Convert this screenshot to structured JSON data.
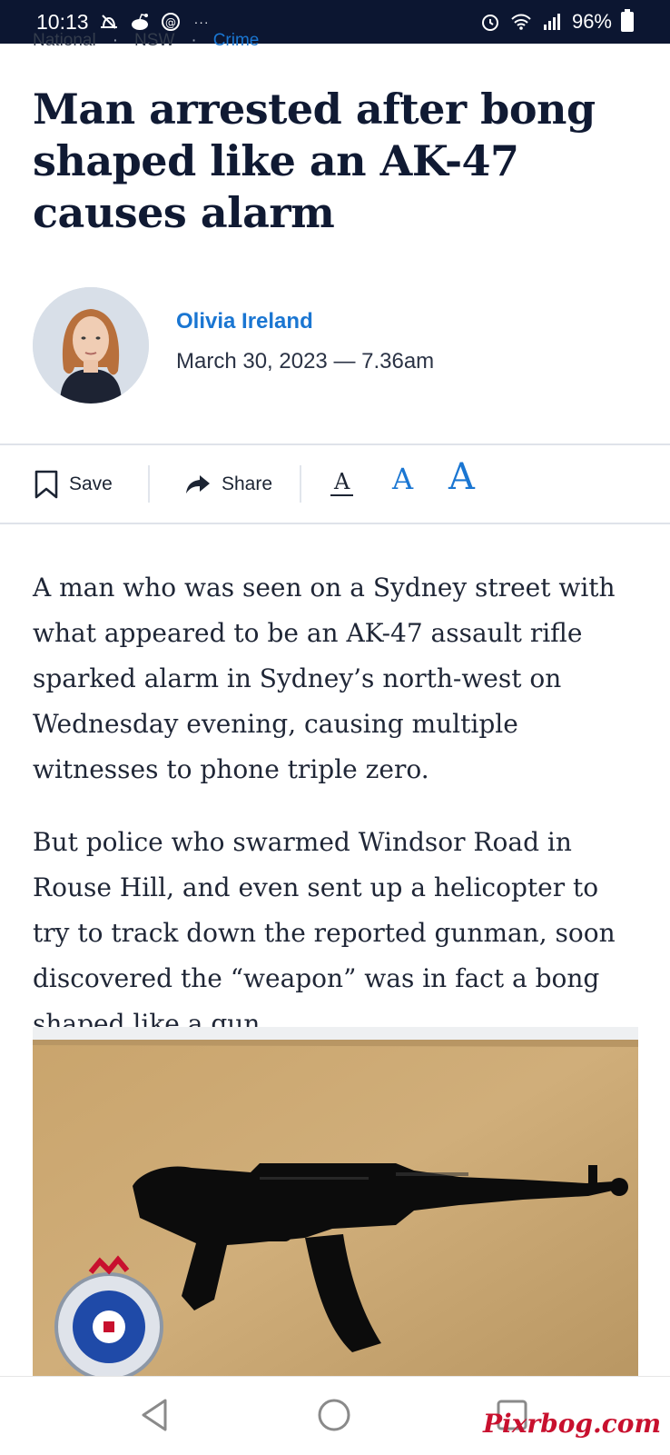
{
  "status_bar": {
    "time": "10:13",
    "more": "···",
    "battery": "96%",
    "icons": [
      "blocked-notification-icon",
      "reddit-icon",
      "app-icon",
      "alarm-icon",
      "wifi-icon",
      "signal-icon",
      "battery-icon"
    ]
  },
  "breadcrumb": {
    "items": [
      "National",
      "NSW",
      "Crime"
    ]
  },
  "article": {
    "title": "Man arrested after bong shaped like an AK-47 causes alarm",
    "author": "Olivia Ireland",
    "date": "March 30, 2023 — 7.36am",
    "paragraphs": [
      "A man who was seen on a Sydney street with what appeared to be an AK-47 assault rifle sparked alarm in Sydney’s north-west on Wednesday evening, causing multiple witnesses to phone triple zero.",
      "But police who swarmed Windsor Road in Rouse Hill, and even sent up a helicopter to try to track down the reported gunman, soon discovered the “weapon” was in fact a bong shaped like a gun."
    ]
  },
  "toolbar": {
    "save_label": "Save",
    "share_label": "Share",
    "font_sizes": [
      "A",
      "A",
      "A"
    ]
  },
  "watermark": "Pixrbog.com",
  "colors": {
    "accent": "#1a76d2",
    "statusbar": "#0c1631",
    "title": "#101a33"
  }
}
